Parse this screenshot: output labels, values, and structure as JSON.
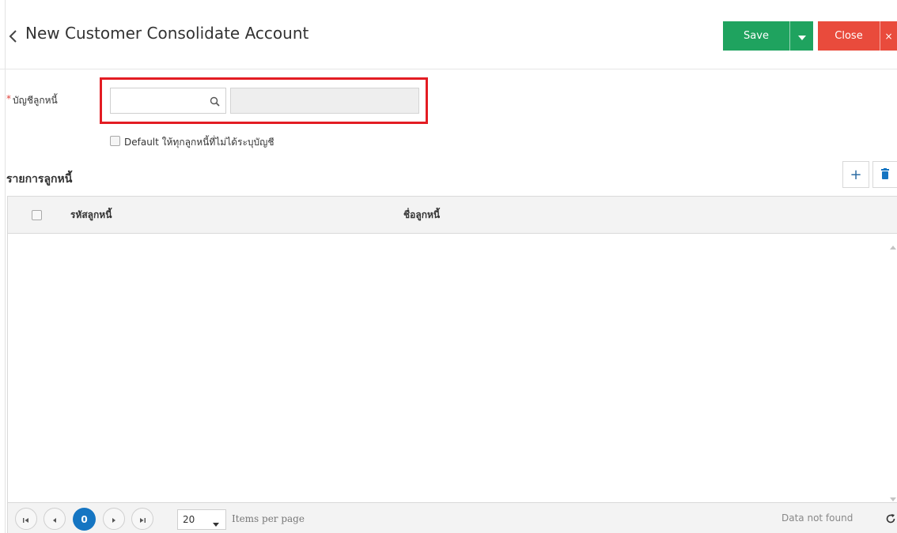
{
  "header": {
    "title": "New Customer Consolidate Account",
    "save_label": "Save",
    "close_label": "Close",
    "close_x": "×"
  },
  "form": {
    "required_mark": "*",
    "account_label": "บัญชีลูกหนี้",
    "account_code_value": "",
    "account_name_value": "",
    "default_checkbox_label": "Default ให้ทุกลูกหนี้ที่ไม่ได้ระบุบัญชี",
    "default_checked": false
  },
  "debtor_list": {
    "title": "รายการลูกหนี้",
    "add_label": "+",
    "columns": [
      "รหัสลูกหนี้",
      "ชื่อลูกหนี้"
    ],
    "rows": []
  },
  "pager": {
    "current_page": "0",
    "page_size": "20",
    "items_per_page_label": "Items per page",
    "status": "Data not found"
  },
  "colors": {
    "save_green": "#1fa35f",
    "close_red": "#e94b3c",
    "highlight_red": "#e31c23",
    "pager_blue": "#1575c2"
  },
  "icons": [
    "chevron-left-icon",
    "caret-down-icon",
    "close-icon",
    "search-icon",
    "plus-icon",
    "trash-icon",
    "first-page-icon",
    "prev-page-icon",
    "next-page-icon",
    "last-page-icon",
    "refresh-icon"
  ]
}
